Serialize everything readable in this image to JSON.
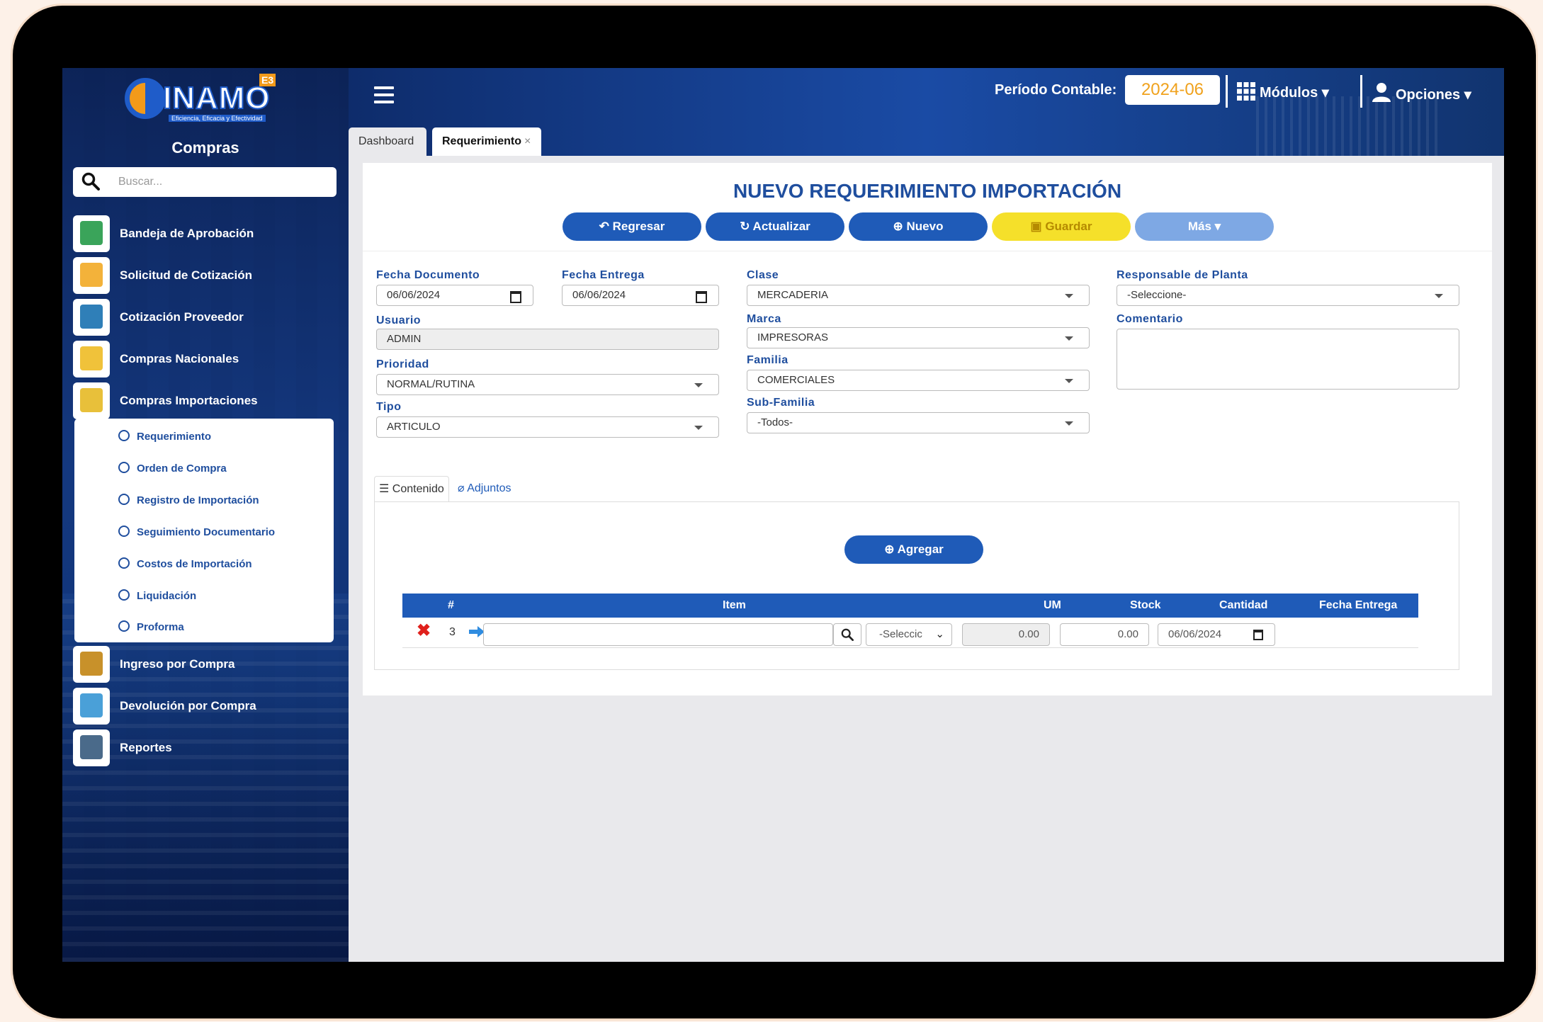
{
  "app": {
    "logo_word": "INAMO",
    "logo_badge": "E3",
    "logo_tagline": "Eficiencia, Eficacia y Efectividad",
    "module_title": "Compras"
  },
  "search": {
    "placeholder": "Buscar..."
  },
  "sidebar": {
    "items": [
      {
        "label": "Bandeja de Aprobación",
        "icon": "approval-tray-icon"
      },
      {
        "label": "Solicitud de Cotización",
        "icon": "quote-request-icon"
      },
      {
        "label": "Cotización Proveedor",
        "icon": "supplier-quote-icon"
      },
      {
        "label": "Compras Nacionales",
        "icon": "national-purchases-icon"
      },
      {
        "label": "Compras Importaciones",
        "icon": "import-purchases-icon"
      },
      {
        "label": "Ingreso por Compra",
        "icon": "purchase-entry-icon"
      },
      {
        "label": "Devolución por Compra",
        "icon": "purchase-return-icon"
      },
      {
        "label": "Reportes",
        "icon": "reports-icon"
      }
    ],
    "submenu": [
      "Requerimiento",
      "Orden de Compra",
      "Registro de Importación",
      "Seguimiento Documentario",
      "Costos de Importación",
      "Liquidación",
      "Proforma"
    ]
  },
  "topbar": {
    "periodo_label": "Período Contable:",
    "periodo_value": "2024-06",
    "modulos_label": "Módulos",
    "opciones_label": "Opciones"
  },
  "tabs": [
    {
      "label": "Dashboard"
    },
    {
      "label": "Requerimiento",
      "close": "×"
    }
  ],
  "page": {
    "title": "NUEVO REQUERIMIENTO IMPORTACIÓN",
    "buttons": {
      "regresar": "Regresar",
      "actualizar": "Actualizar",
      "nuevo": "Nuevo",
      "guardar": "Guardar",
      "mas": "Más"
    }
  },
  "form": {
    "fecha_documento": {
      "label": "Fecha Documento",
      "value": "06/06/2024"
    },
    "fecha_entrega": {
      "label": "Fecha Entrega",
      "value": "06/06/2024"
    },
    "usuario": {
      "label": "Usuario",
      "value": "ADMIN"
    },
    "prioridad": {
      "label": "Prioridad",
      "value": "NORMAL/RUTINA"
    },
    "tipo": {
      "label": "Tipo",
      "value": "ARTICULO"
    },
    "clase": {
      "label": "Clase",
      "value": "MERCADERIA"
    },
    "marca": {
      "label": "Marca",
      "value": "IMPRESORAS"
    },
    "familia": {
      "label": "Familia",
      "value": "COMERCIALES"
    },
    "subfamilia": {
      "label": "Sub-Familia",
      "value": "-Todos-"
    },
    "responsable": {
      "label": "Responsable de Planta",
      "value": "-Seleccione-"
    },
    "comentario": {
      "label": "Comentario",
      "value": ""
    }
  },
  "content_tabs": {
    "contenido": "Contenido",
    "adjuntos": "Adjuntos"
  },
  "table": {
    "agregar_label": "Agregar",
    "headers": [
      "#",
      "Item",
      "UM",
      "Stock",
      "Cantidad",
      "Fecha Entrega"
    ],
    "rows": [
      {
        "num": "3",
        "item": "",
        "um": "-Seleccic",
        "stock": "0.00",
        "cantidad": "0.00",
        "fecha_entrega": "06/06/2024"
      }
    ]
  }
}
